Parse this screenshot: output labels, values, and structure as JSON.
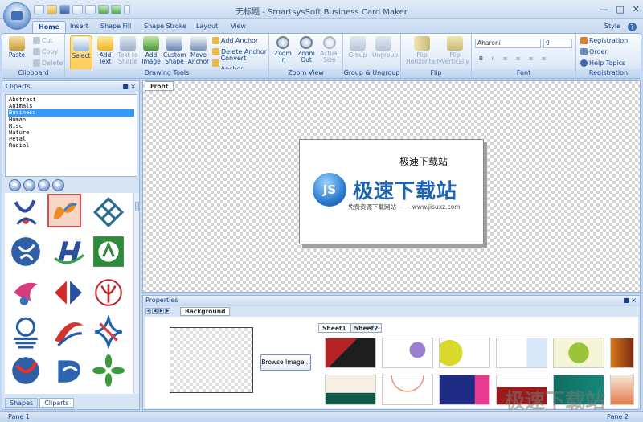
{
  "window": {
    "title": "无标题 - SmartsysSoft Business Card Maker"
  },
  "ribbon_tabs": [
    "Home",
    "Insert",
    "Shape Fill",
    "Shape Stroke",
    "Layout",
    "View"
  ],
  "style_menu": "Style",
  "help_symbol": "?",
  "clipboard": {
    "paste": "Paste",
    "cut": "Cut",
    "copy": "Copy",
    "delete": "Delete",
    "caption": "Clipboard"
  },
  "drawing_tools": {
    "select": "Select",
    "add_text": "Add Text",
    "text_to_shape": "Text to Shape",
    "add_image": "Add Image",
    "custom_shape": "Custom Shape",
    "move_anchor": "Move Anchor",
    "add_anchor": "Add Anchor",
    "delete_anchor": "Delete Anchor",
    "convert_anchor": "Convert Anchor",
    "caption": "Drawing Tools"
  },
  "zoom_view": {
    "zoom_in": "Zoom In",
    "zoom_out": "Zoom Out",
    "actual_size": "Actual Size",
    "caption": "Zoom View"
  },
  "group_ungroup": {
    "group": "Group",
    "ungroup": "Ungroup",
    "caption": "Group & Ungroup"
  },
  "flip": {
    "horizontal": "Flip Horizontally",
    "vertical": "Flip Vertically",
    "caption": "Flip"
  },
  "font": {
    "name": "Aharoni",
    "size": "9",
    "bold": "B",
    "italic": "I",
    "caption": "Font"
  },
  "registration": {
    "registration": "Registration",
    "order": "Order",
    "help_topics": "Help Topics",
    "caption": "Registration"
  },
  "cliparts": {
    "title": "Cliparts",
    "categories": [
      "Abstract",
      "Animals",
      "Business",
      "Human",
      "Misc",
      "Nature",
      "Petal",
      "Radial"
    ],
    "selected_category": "Business"
  },
  "left_tabs": {
    "shapes": "Shapes",
    "cliparts": "Cliparts"
  },
  "canvas": {
    "tab": "Front"
  },
  "card": {
    "title": "极速下载站",
    "logo_letters": "JS",
    "logo_text": "极速下载站",
    "logo_sub": "免费资源下载网站 —— www.jisuxz.com"
  },
  "properties": {
    "title": "Properties",
    "background_tab": "Background",
    "browse_button": "Browse Image..."
  },
  "sheets": {
    "sheet1": "Sheet1",
    "sheet2": "Sheet2"
  },
  "status": {
    "pane1": "Pane 1",
    "pane2": "Pane 2"
  },
  "watermark": "极速下载站",
  "colors": {
    "ribbon_blue": "#15428b",
    "selected_list": "#3399ff",
    "logo_blue": "#1d63b3"
  }
}
